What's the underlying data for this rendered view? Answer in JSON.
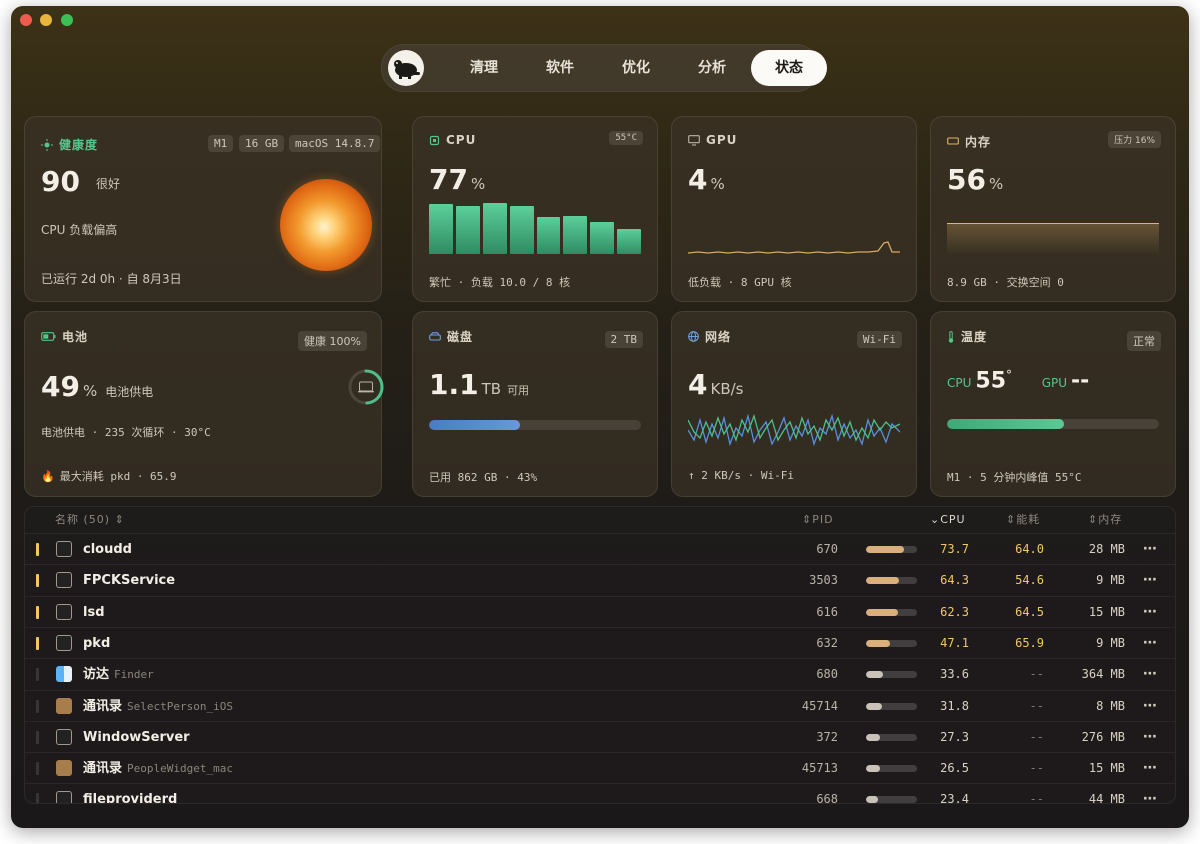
{
  "nav": {
    "tabs": [
      "清理",
      "软件",
      "优化",
      "分析",
      "状态"
    ],
    "active": "状态"
  },
  "health": {
    "title": "健康度",
    "badges": [
      "M1",
      "16 GB",
      "macOS 14.8.7"
    ],
    "score": "90",
    "rating": "很好",
    "status": "CPU 负载偏高",
    "uptime": "已运行 2d 0h · 自 8月3日"
  },
  "cpu": {
    "title": "CPU",
    "temp": "55°C",
    "value": "77",
    "unit": "%",
    "foot": "繁忙 · 负载 10.0 / 8 核",
    "cores": [
      0.94,
      0.9,
      0.96,
      0.91,
      0.7,
      0.71,
      0.6,
      0.47
    ]
  },
  "gpu": {
    "title": "GPU",
    "value": "4",
    "unit": "%",
    "foot": "低负载 · 8 GPU 核"
  },
  "memory": {
    "title": "内存",
    "pressure": "压力 16%",
    "value": "56",
    "unit": "%",
    "foot": "8.9 GB · 交换空间 0"
  },
  "battery": {
    "title": "电池",
    "health": "健康 100%",
    "value": "49",
    "unit": "%",
    "state": "电池供电",
    "detail": "电池供电 · 235 次循环 · 30°C",
    "top": "最大消耗 pkd · 65.9",
    "level": 0.49
  },
  "disk": {
    "title": "磁盘",
    "size": "2 TB",
    "value": "1.1",
    "unit": "TB",
    "avail": "可用",
    "foot": "已用 862 GB · 43%",
    "used": 0.43
  },
  "network": {
    "title": "网络",
    "type": "Wi-Fi",
    "value": "4",
    "unit": "KB/s",
    "foot": "↑ 2 KB/s · Wi-Fi"
  },
  "temperature": {
    "title": "温度",
    "status": "正常",
    "cpu_label": "CPU",
    "cpu_value": "55",
    "cpu_unit": "°",
    "gpu_label": "GPU",
    "gpu_value": "--",
    "level": 0.55,
    "foot": "M1 · 5 分钟内峰值 55°C"
  },
  "table": {
    "headers": {
      "name": "名称",
      "count": "(50)",
      "pid": "PID",
      "cpu": "CPU",
      "energy": "能耗",
      "memory": "内存"
    },
    "rows": [
      {
        "name": "cloudd",
        "secondary": "",
        "pid": "670",
        "cpu": "73.7",
        "energy": "64.0",
        "mem": "28 MB",
        "hot": true
      },
      {
        "name": "FPCKService",
        "secondary": "",
        "pid": "3503",
        "cpu": "64.3",
        "energy": "54.6",
        "mem": "9 MB",
        "hot": true
      },
      {
        "name": "lsd",
        "secondary": "",
        "pid": "616",
        "cpu": "62.3",
        "energy": "64.5",
        "mem": "15 MB",
        "hot": true
      },
      {
        "name": "pkd",
        "secondary": "",
        "pid": "632",
        "cpu": "47.1",
        "energy": "65.9",
        "mem": "9 MB",
        "hot": true
      },
      {
        "name": "访达",
        "secondary": "Finder",
        "pid": "680",
        "cpu": "33.6",
        "energy": "--",
        "mem": "364 MB",
        "hot": false
      },
      {
        "name": "通讯录",
        "secondary": "SelectPerson_iOS",
        "pid": "45714",
        "cpu": "31.8",
        "energy": "--",
        "mem": "8 MB",
        "hot": false
      },
      {
        "name": "WindowServer",
        "secondary": "",
        "pid": "372",
        "cpu": "27.3",
        "energy": "--",
        "mem": "276 MB",
        "hot": false
      },
      {
        "name": "通讯录",
        "secondary": "PeopleWidget_mac",
        "pid": "45713",
        "cpu": "26.5",
        "energy": "--",
        "mem": "15 MB",
        "hot": false
      },
      {
        "name": "fileproviderd",
        "secondary": "",
        "pid": "668",
        "cpu": "23.4",
        "energy": "--",
        "mem": "44 MB",
        "hot": false
      }
    ],
    "more_symbol": "⋯"
  },
  "colors": {
    "accent_green": "#4fbf8a",
    "hot": "#f0c860",
    "bar_hot": "#d9b07c",
    "bar_cool": "#c8c2b8"
  }
}
